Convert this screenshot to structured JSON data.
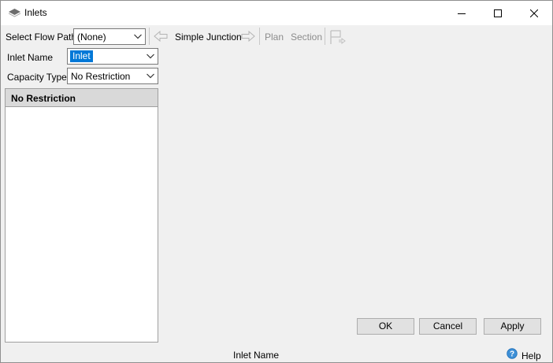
{
  "window": {
    "title": "Inlets",
    "icons": {
      "app": "stack-layers-icon",
      "minimize": "minimize-icon",
      "maximize": "maximize-icon",
      "close": "close-icon"
    }
  },
  "toolbar": {
    "flow_path_label": "Select Flow Path",
    "flow_path_value": "(None)",
    "prev_label": "",
    "junction_label": "Simple Junction",
    "plan_label": "Plan",
    "section_label": "Section"
  },
  "form": {
    "inlet_name_label": "Inlet Name",
    "inlet_name_value": "Inlet",
    "capacity_type_label": "Capacity Type",
    "capacity_type_value": "No Restriction"
  },
  "panel": {
    "header": "No Restriction"
  },
  "buttons": {
    "ok": "OK",
    "cancel": "Cancel",
    "apply": "Apply"
  },
  "status": {
    "text": "Inlet Name",
    "help": "Help"
  }
}
